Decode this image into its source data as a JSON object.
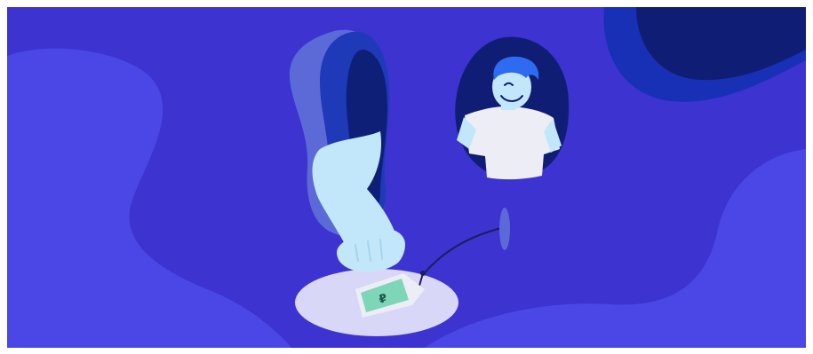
{
  "illustration": {
    "currency_symbol": "₽",
    "colors": {
      "background": "#3C33D0",
      "blob_light": "#4B47E6",
      "blob_dark": "#0F1E74",
      "blob_mid": "#1730B6",
      "arm": "#C3E7FA",
      "shirt": "#EDEDF6",
      "hair": "#2E6BF0",
      "spotlight": "#D9D7F7",
      "banknote": "#7DD6B8"
    }
  }
}
